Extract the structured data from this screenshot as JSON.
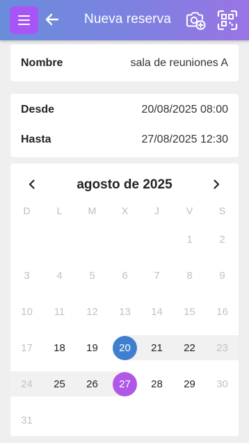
{
  "header": {
    "title": "Nueva reserva",
    "menu_icon": "hamburger-menu-icon",
    "back_icon": "arrow-left-icon",
    "camera_icon": "camera-add-icon",
    "qr_icon": "qr-scan-icon",
    "gradient_start": "#6a8ddb",
    "gradient_end": "#9a74e4",
    "menu_button_color": "#a855f7"
  },
  "name_card": {
    "label": "Nombre",
    "value": "sala de reuniones A"
  },
  "dates_card": {
    "from_label": "Desde",
    "from_value": "20/08/2025 08:00",
    "to_label": "Hasta",
    "to_value": "27/08/2025 12:30"
  },
  "calendar": {
    "month_label": "agosto de 2025",
    "weekdays": [
      "D",
      "L",
      "M",
      "X",
      "J",
      "V",
      "S"
    ],
    "weeks": [
      [
        "",
        "",
        "",
        "",
        "",
        "1",
        "2"
      ],
      [
        "3",
        "4",
        "5",
        "6",
        "7",
        "8",
        "9"
      ],
      [
        "10",
        "11",
        "12",
        "13",
        "14",
        "15",
        "16"
      ],
      [
        "17",
        "18",
        "19",
        "20",
        "21",
        "22",
        "23"
      ],
      [
        "24",
        "25",
        "26",
        "27",
        "28",
        "29",
        "30"
      ],
      [
        "31",
        "",
        "",
        "",
        "",
        "",
        ""
      ]
    ],
    "selected_start": "20",
    "selected_end": "27",
    "start_color": "#3f7fcf",
    "end_color": "#b057e6"
  }
}
